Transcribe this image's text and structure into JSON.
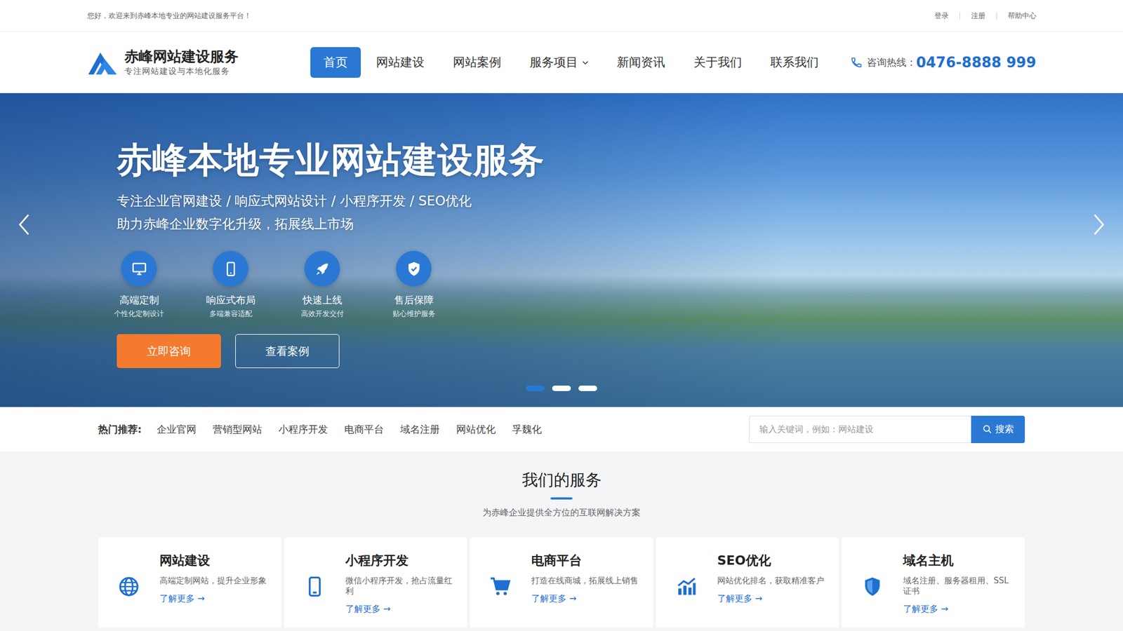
{
  "topbar": {
    "welcome": "您好，欢迎来到赤峰本地专业的网站建设服务平台！",
    "links": [
      "登录",
      "注册",
      "帮助中心"
    ]
  },
  "brand": {
    "name": "赤峰网站建设服务",
    "slogan": "专注网站建设与本地化服务"
  },
  "nav": [
    {
      "label": "首页",
      "selected": true,
      "dropdown": false
    },
    {
      "label": "网站建设",
      "selected": false,
      "dropdown": false
    },
    {
      "label": "网站案例",
      "selected": false,
      "dropdown": false
    },
    {
      "label": "服务项目",
      "selected": false,
      "dropdown": true
    },
    {
      "label": "新闻资讯",
      "selected": false,
      "dropdown": false
    },
    {
      "label": "关于我们",
      "selected": false,
      "dropdown": false
    },
    {
      "label": "联系我们",
      "selected": false,
      "dropdown": false
    }
  ],
  "hotline": {
    "label": "咨询热线：",
    "number": "0476-8888 999"
  },
  "banner": {
    "title": "赤峰本地专业网站建设服务",
    "lines": [
      "专注企业官网建设 / 响应式网站设计 / 小程序开发 / SEO优化",
      "助力赤峰企业数字化升级，拓展线上市场"
    ],
    "features": [
      {
        "title": "高端定制",
        "desc": "个性化定制设计"
      },
      {
        "title": "响应式布局",
        "desc": "多端兼容适配"
      },
      {
        "title": "快速上线",
        "desc": "高效开发交付"
      },
      {
        "title": "售后保障",
        "desc": "贴心维护服务"
      }
    ],
    "buttons": [
      "立即咨询",
      "查看案例"
    ],
    "dots": [
      {
        "selected": true
      },
      {
        "selected": false
      },
      {
        "selected": false
      }
    ]
  },
  "hot": {
    "label": "热门推荐:",
    "items": [
      "企业官网",
      "营销型网站",
      "小程序开发",
      "电商平台",
      "域名注册",
      "网站优化",
      "孚魏化"
    ]
  },
  "search": {
    "placeholder": "输入关键词，例如：网站建设",
    "button": "搜索"
  },
  "services": {
    "title": "我们的服务",
    "subtitle": "为赤峰企业提供全方位的互联网解决方案",
    "cards": [
      {
        "title": "网站建设",
        "desc": "高端定制网站，提升企业形象",
        "link": "了解更多 →"
      },
      {
        "title": "小程序开发",
        "desc": "微信小程序开发，抢占流量红利",
        "link": "了解更多 →"
      },
      {
        "title": "电商平台",
        "desc": "打造在线商城，拓展线上销售",
        "link": "了解更多 →"
      },
      {
        "title": "SEO优化",
        "desc": "网站优化排名，获取精准客户",
        "link": "了解更多 →"
      },
      {
        "title": "域名主机",
        "desc": "域名注册、服务器租用、SSL证书",
        "link": "了解更多 →"
      }
    ]
  }
}
